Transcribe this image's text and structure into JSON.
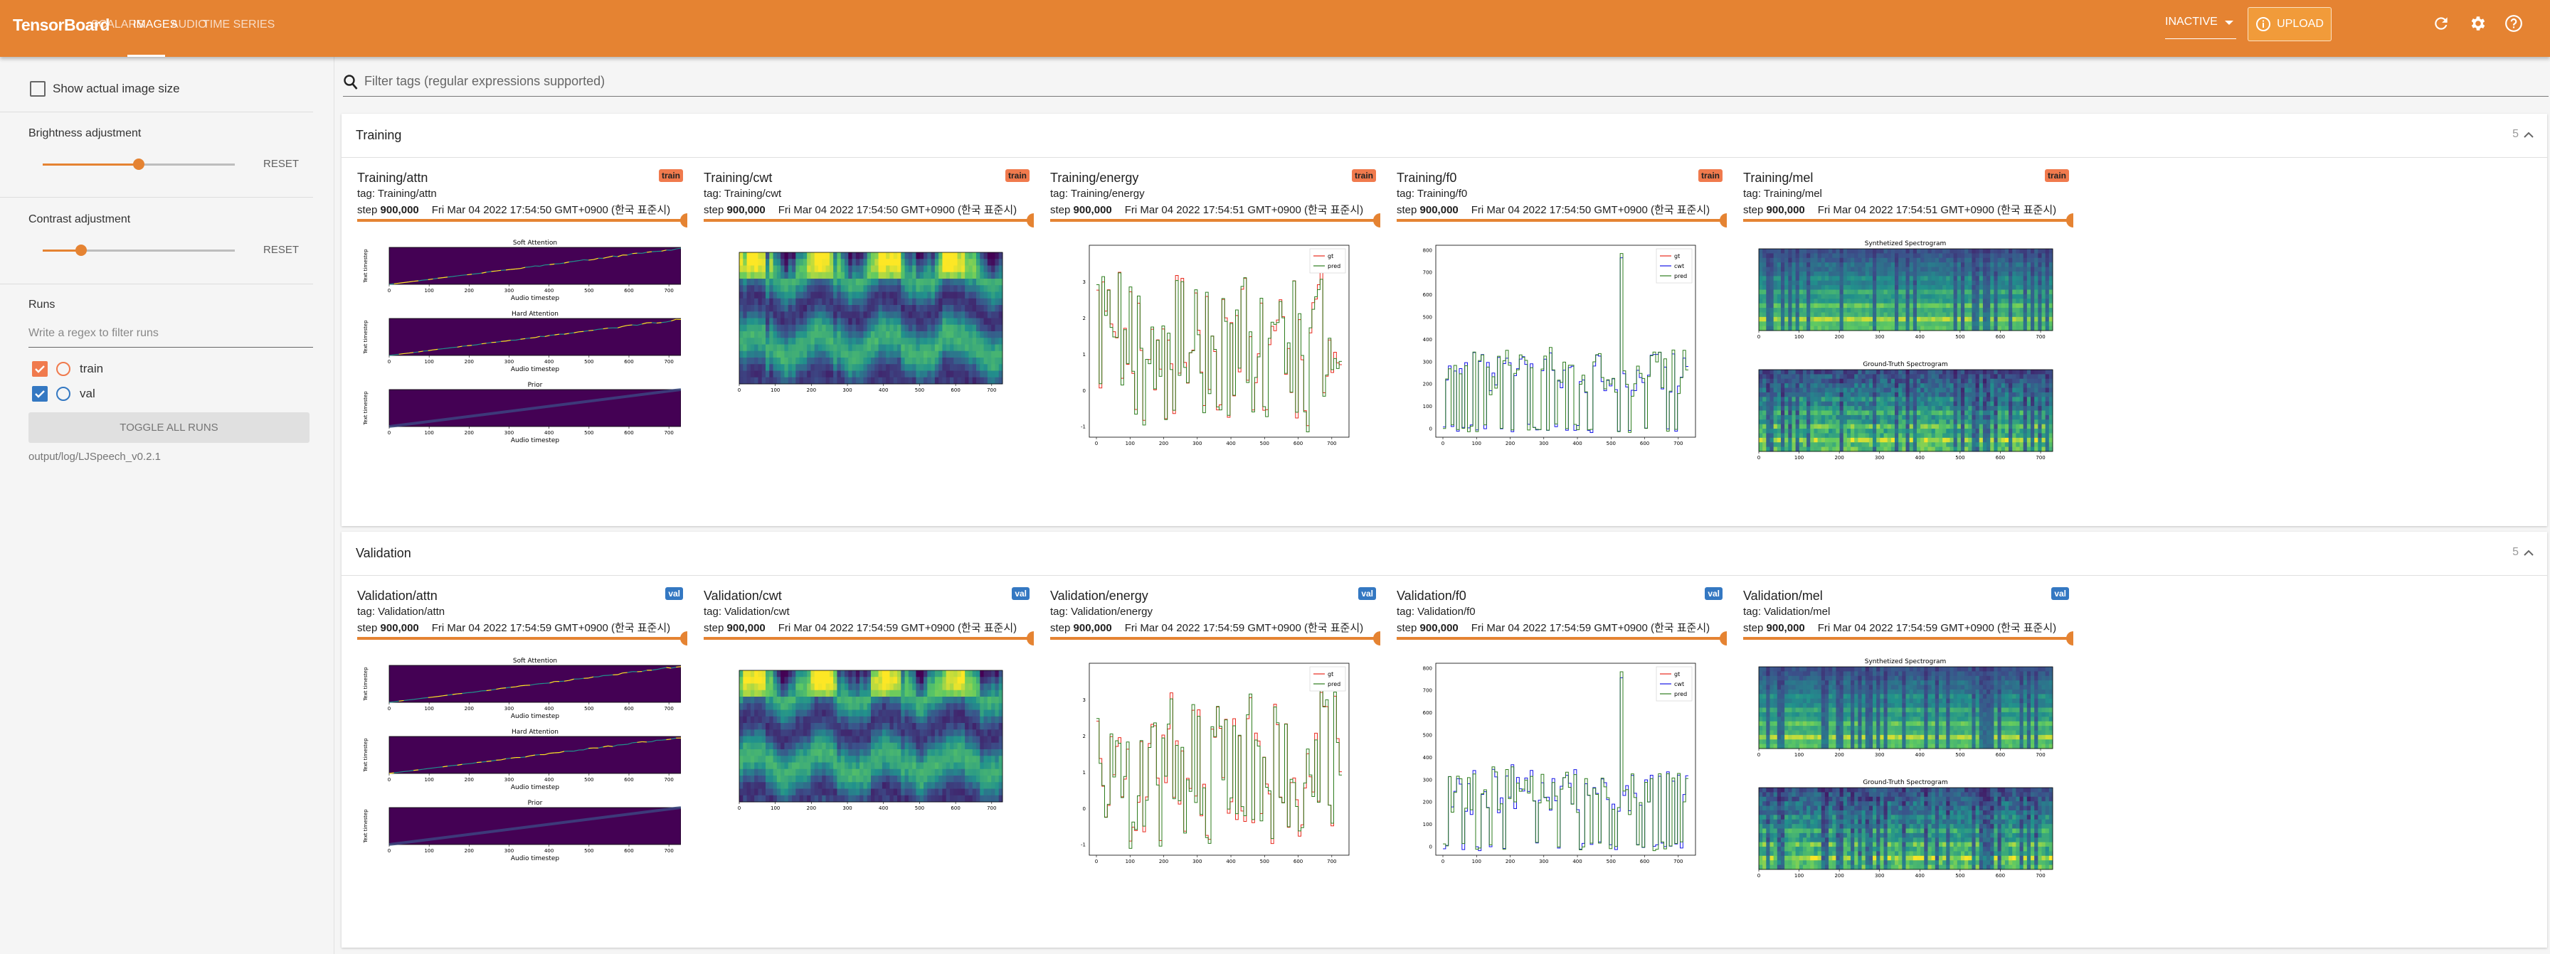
{
  "header": {
    "brand": "TensorBoard",
    "tabs": [
      {
        "label": "SCALARS"
      },
      {
        "label": "IMAGES",
        "active": true
      },
      {
        "label": "AUDIO"
      },
      {
        "label": "TIME SERIES"
      }
    ],
    "run_select": "INACTIVE",
    "upload": "UPLOAD",
    "accent": "#e58332"
  },
  "filter": {
    "placeholder": "Filter tags (regular expressions supported)"
  },
  "sidebar": {
    "show_actual_size": "Show actual image size",
    "show_actual_size_checked": false,
    "brightness": {
      "label": "Brightness adjustment",
      "value": 0.5,
      "reset": "RESET"
    },
    "contrast": {
      "label": "Contrast adjustment",
      "value": 0.2,
      "reset": "RESET"
    },
    "runs": {
      "title": "Runs",
      "filter_placeholder": "Write a regex to filter runs",
      "items": [
        {
          "name": "train",
          "checked": true,
          "color": "#f07a4d"
        },
        {
          "name": "val",
          "checked": true,
          "color": "#3478c2"
        }
      ],
      "toggle": "TOGGLE ALL RUNS",
      "logdir": "output/log/LJSpeech_v0.2.1"
    }
  },
  "plot_labels": {
    "attn_titles": [
      "Soft Attention",
      "Hard Attention",
      "Prior"
    ],
    "attn_xlabel": "Audio timestep",
    "attn_ylabel": "Text timestep",
    "mel_titles": [
      "Synthetized Spectrogram",
      "Ground-Truth Spectrogram"
    ],
    "legend_energy": [
      "gt",
      "pred"
    ],
    "legend_f0": [
      "gt",
      "cwt",
      "pred"
    ]
  },
  "sections": [
    {
      "title": "Training",
      "count": "5",
      "run": "train",
      "cells": [
        {
          "title": "Training/attn",
          "tag": "tag: Training/attn",
          "step": "900,000",
          "time": "Fri Mar 04 2022 17:54:50 GMT+0900 (한국 표준시)",
          "type": "attn"
        },
        {
          "title": "Training/cwt",
          "tag": "tag: Training/cwt",
          "step": "900,000",
          "time": "Fri Mar 04 2022 17:54:50 GMT+0900 (한국 표준시)",
          "type": "cwt"
        },
        {
          "title": "Training/energy",
          "tag": "tag: Training/energy",
          "step": "900,000",
          "time": "Fri Mar 04 2022 17:54:51 GMT+0900 (한국 표준시)",
          "type": "energy"
        },
        {
          "title": "Training/f0",
          "tag": "tag: Training/f0",
          "step": "900,000",
          "time": "Fri Mar 04 2022 17:54:50 GMT+0900 (한국 표준시)",
          "type": "f0"
        },
        {
          "title": "Training/mel",
          "tag": "tag: Training/mel",
          "step": "900,000",
          "time": "Fri Mar 04 2022 17:54:51 GMT+0900 (한국 표준시)",
          "type": "mel"
        }
      ]
    },
    {
      "title": "Validation",
      "count": "5",
      "run": "val",
      "cells": [
        {
          "title": "Validation/attn",
          "tag": "tag: Validation/attn",
          "step": "900,000",
          "time": "Fri Mar 04 2022 17:54:59 GMT+0900 (한국 표준시)",
          "type": "attn"
        },
        {
          "title": "Validation/cwt",
          "tag": "tag: Validation/cwt",
          "step": "900,000",
          "time": "Fri Mar 04 2022 17:54:59 GMT+0900 (한국 표준시)",
          "type": "cwt"
        },
        {
          "title": "Validation/energy",
          "tag": "tag: Validation/energy",
          "step": "900,000",
          "time": "Fri Mar 04 2022 17:54:59 GMT+0900 (한국 표준시)",
          "type": "energy"
        },
        {
          "title": "Validation/f0",
          "tag": "tag: Validation/f0",
          "step": "900,000",
          "time": "Fri Mar 04 2022 17:54:59 GMT+0900 (한국 표준시)",
          "type": "f0"
        },
        {
          "title": "Validation/mel",
          "tag": "tag: Validation/mel",
          "step": "900,000",
          "time": "Fri Mar 04 2022 17:54:59 GMT+0900 (한국 표준시)",
          "type": "mel"
        }
      ]
    }
  ]
}
